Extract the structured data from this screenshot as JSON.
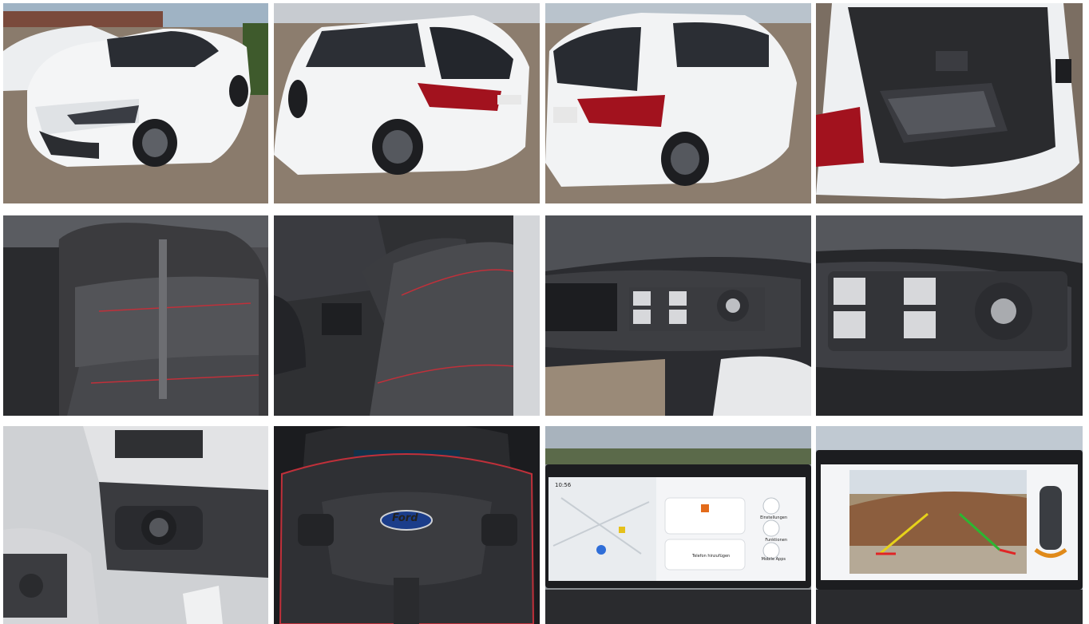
{
  "gallery": {
    "photos": [
      {
        "id": "photo-1"
      },
      {
        "id": "photo-2"
      },
      {
        "id": "photo-3"
      },
      {
        "id": "photo-4"
      },
      {
        "id": "photo-5"
      },
      {
        "id": "photo-6"
      },
      {
        "id": "photo-7"
      },
      {
        "id": "photo-8"
      },
      {
        "id": "photo-9"
      },
      {
        "id": "photo-10"
      },
      {
        "id": "photo-11"
      },
      {
        "id": "photo-12"
      }
    ]
  },
  "steering": {
    "logo_text": "Ford"
  },
  "infotainment": {
    "time": "10:56",
    "settings": "Einstellungen",
    "functions": "Funktionen",
    "phone": "Telefon hinzufügen",
    "mobile": "Mobile Apps"
  },
  "colors": {
    "paint": "#f2f3f4",
    "cobblestone": "#8a7b6c",
    "upholstery": "#3b3b3e",
    "stitching": "#c0303a",
    "screen_bg": "#f4f5f7",
    "rear_light": "#a2121e"
  }
}
